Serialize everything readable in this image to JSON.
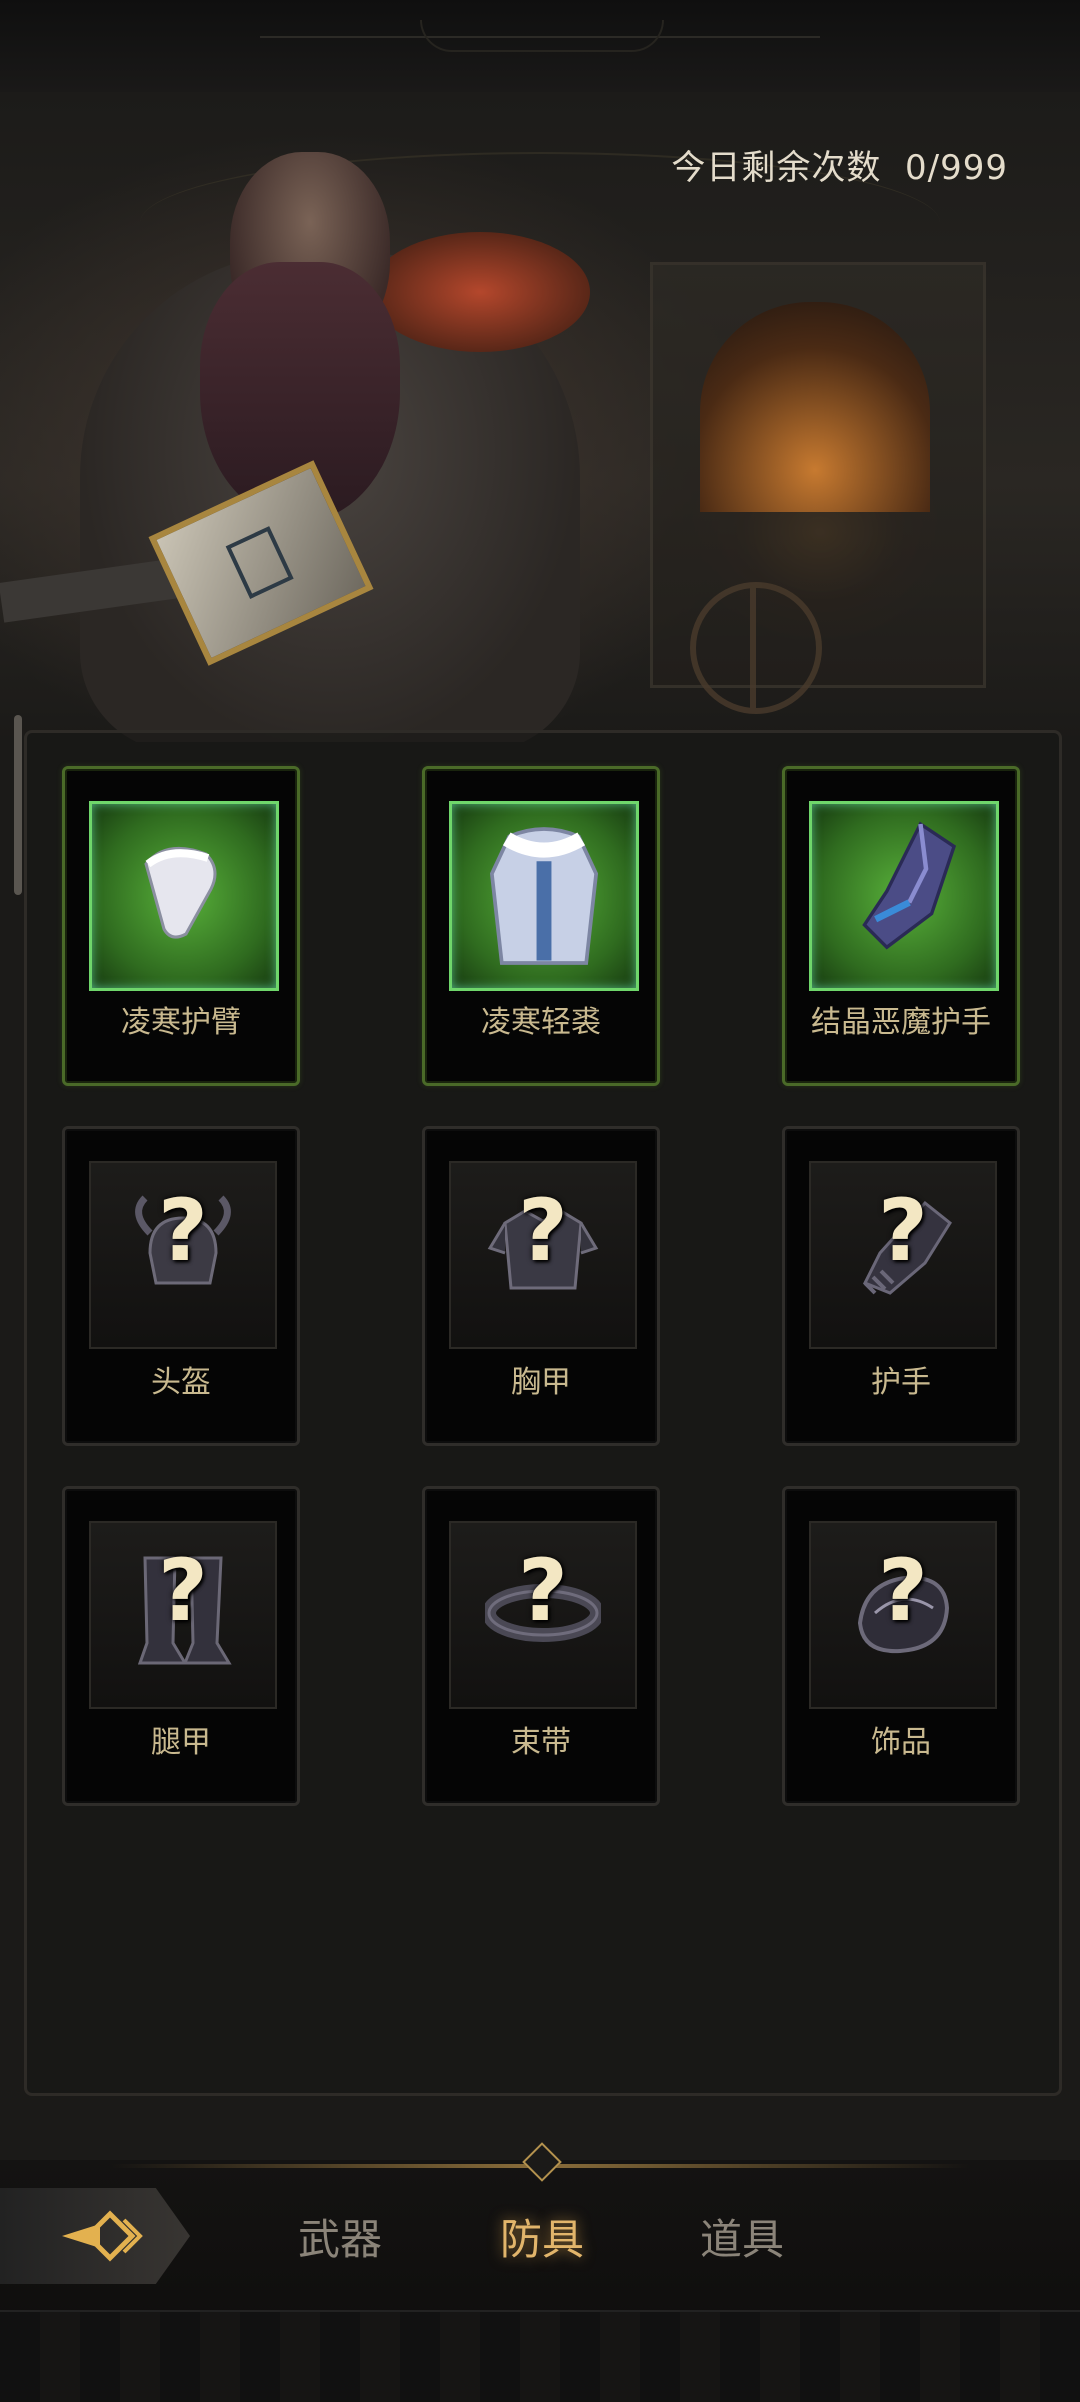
{
  "header": {
    "remaining_label": "今日剩余次数",
    "remaining_value": "0/999"
  },
  "items": [
    {
      "name": "凌寒护臂",
      "owned": true,
      "icon": "arm-guard-icon"
    },
    {
      "name": "凌寒轻裘",
      "owned": true,
      "icon": "fur-coat-icon"
    },
    {
      "name": "结晶恶魔护手",
      "owned": true,
      "icon": "crystal-gauntlet-icon"
    },
    {
      "name": "头盔",
      "owned": false,
      "icon": "helmet-icon",
      "unknown_mark": "?"
    },
    {
      "name": "胸甲",
      "owned": false,
      "icon": "chest-armor-icon",
      "unknown_mark": "?"
    },
    {
      "name": "护手",
      "owned": false,
      "icon": "gauntlet-icon",
      "unknown_mark": "?"
    },
    {
      "name": "腿甲",
      "owned": false,
      "icon": "leg-armor-icon",
      "unknown_mark": "?"
    },
    {
      "name": "束带",
      "owned": false,
      "icon": "belt-icon",
      "unknown_mark": "?"
    },
    {
      "name": "饰品",
      "owned": false,
      "icon": "accessory-icon",
      "unknown_mark": "?"
    }
  ],
  "tabs": [
    {
      "label": "武器",
      "active": false
    },
    {
      "label": "防具",
      "active": true
    },
    {
      "label": "道具",
      "active": false
    }
  ],
  "colors": {
    "owned_border": "#4a6a28",
    "owned_frame": "#58b03a",
    "active_tab": "#e2b56b",
    "inactive_tab": "#8b8479",
    "label_text": "#c9b98f"
  }
}
